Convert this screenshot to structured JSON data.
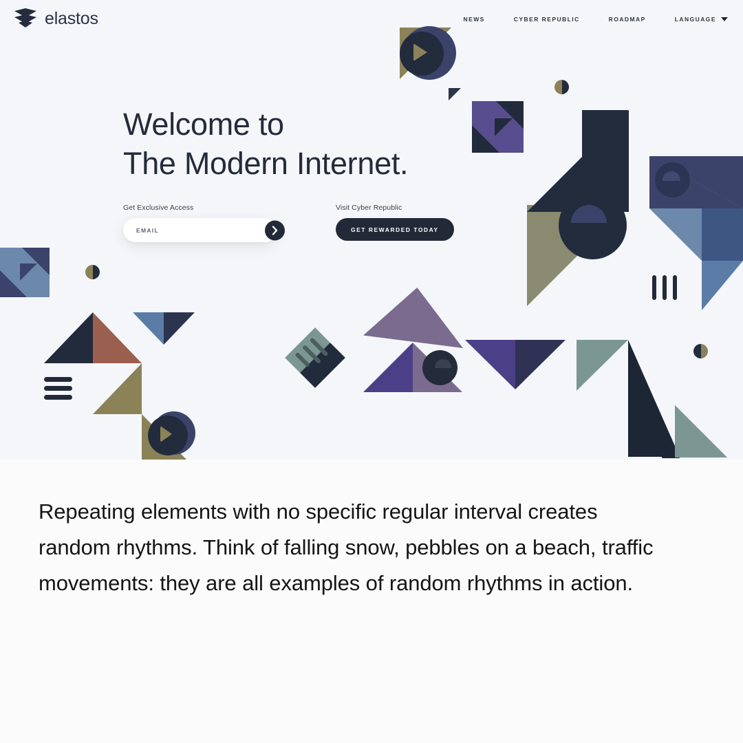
{
  "header": {
    "brand_name": "elastos",
    "logo_icon": "elastos-chevron-logo",
    "nav_items": [
      {
        "label": "NEWS",
        "icon": null
      },
      {
        "label": "CYBER REPUBLIC",
        "icon": null
      },
      {
        "label": "ROADMAP",
        "icon": null
      },
      {
        "label": "LANGUAGE",
        "icon": "chevron-down-icon"
      }
    ]
  },
  "hero": {
    "headline_line1": "Welcome to",
    "headline_line2": "The Modern Internet.",
    "background_color": "#f4f6f9",
    "signup": {
      "label": "Get Exclusive Access",
      "email_placeholder": "EMAIL",
      "email_value": "",
      "submit_icon": "chevron-right-icon"
    },
    "cta": {
      "label": "Visit Cyber Republic",
      "button_label": "GET REWARDED TODAY",
      "button_color": "#222a38"
    }
  },
  "lower": {
    "paragraph": "Repeating elements with no specific regular interval creates random rhythms. Think of falling snow, pebbles on a beach, traffic movements: they are all examples of random rhythms in action.",
    "background_color": "#fbfbfb"
  },
  "palette": {
    "navy": "#232c3d",
    "dark_navy": "#1d2635",
    "slate_purple": "#3c436a",
    "khaki": "#8b8257",
    "olive": "#8a8a70",
    "purple": "#584d8e",
    "deep_purple": "#3f3a72",
    "mauve": "#7b6b8e",
    "steel_blue": "#5c7ca8",
    "blue_grey": "#6c89ab",
    "sage": "#7c9693",
    "rust": "#9a5f4f",
    "light_blue": "#7f9fc4"
  },
  "decor": {
    "icons": [
      "hamburger-bars-icon",
      "vertical-bars-icon",
      "elastos-diamond-icon"
    ]
  }
}
